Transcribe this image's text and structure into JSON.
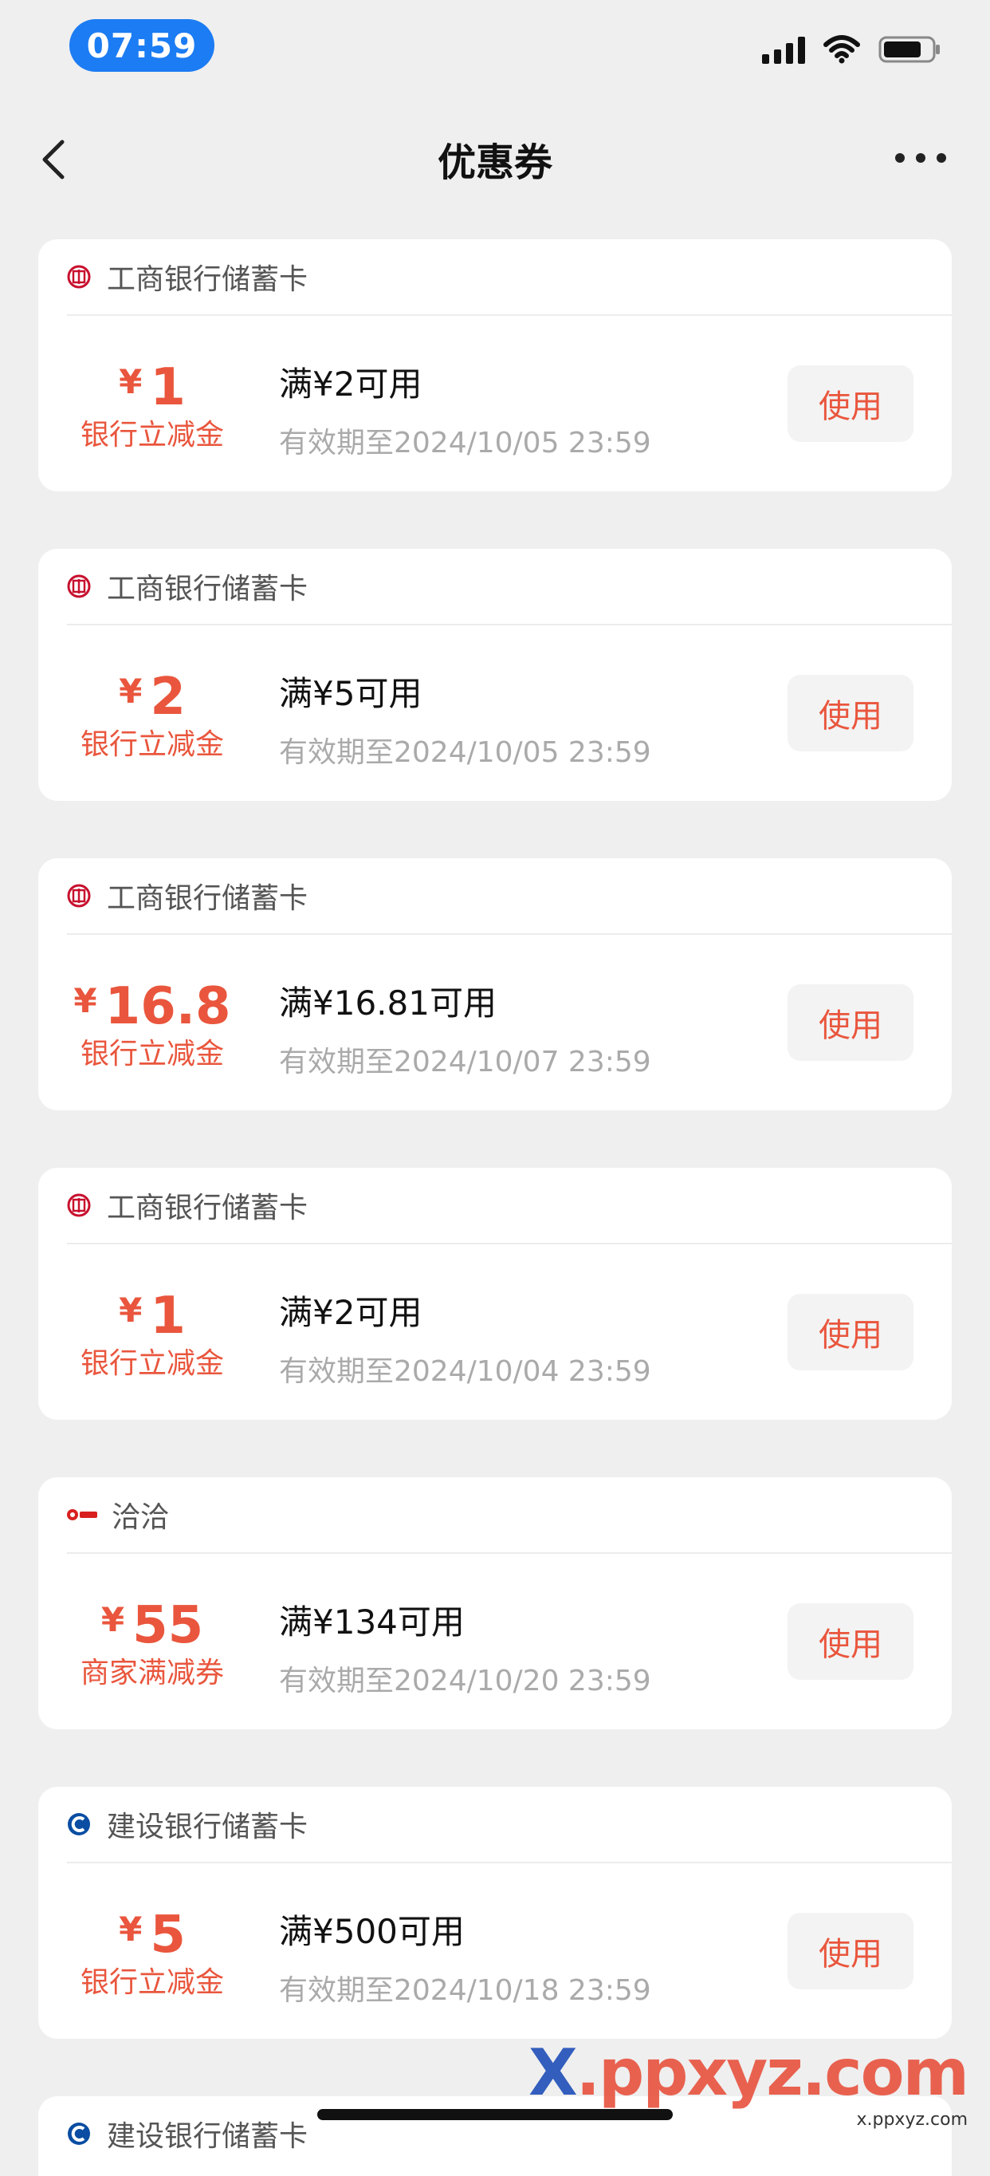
{
  "status_bar": {
    "time": "07:59"
  },
  "nav": {
    "title": "优惠券"
  },
  "colors": {
    "accent": "#e9563d",
    "time_pill": "#1c7cf3",
    "background": "#efefef"
  },
  "coupons": [
    {
      "issuer": "工商银行储蓄卡",
      "logo_icon": "icbc-logo-icon",
      "currency": "¥",
      "amount": "1",
      "type": "银行立减金",
      "condition": "满¥2可用",
      "validity": "有效期至2024/10/05 23:59",
      "button": "使用"
    },
    {
      "issuer": "工商银行储蓄卡",
      "logo_icon": "icbc-logo-icon",
      "currency": "¥",
      "amount": "2",
      "type": "银行立减金",
      "condition": "满¥5可用",
      "validity": "有效期至2024/10/05 23:59",
      "button": "使用"
    },
    {
      "issuer": "工商银行储蓄卡",
      "logo_icon": "icbc-logo-icon",
      "currency": "¥",
      "amount": "16.8",
      "type": "银行立减金",
      "condition": "满¥16.81可用",
      "validity": "有效期至2024/10/07 23:59",
      "button": "使用"
    },
    {
      "issuer": "工商银行储蓄卡",
      "logo_icon": "icbc-logo-icon",
      "currency": "¥",
      "amount": "1",
      "type": "银行立减金",
      "condition": "满¥2可用",
      "validity": "有效期至2024/10/04 23:59",
      "button": "使用"
    },
    {
      "issuer": "洽洽",
      "logo_icon": "qiaqia-logo-icon",
      "currency": "¥",
      "amount": "55",
      "type": "商家满减券",
      "condition": "满¥134可用",
      "validity": "有效期至2024/10/20 23:59",
      "button": "使用"
    },
    {
      "issuer": "建设银行储蓄卡",
      "logo_icon": "ccb-logo-icon",
      "currency": "¥",
      "amount": "5",
      "type": "银行立减金",
      "condition": "满¥500可用",
      "validity": "有效期至2024/10/18 23:59",
      "button": "使用"
    }
  ],
  "partial_coupon": {
    "issuer": "建设银行储蓄卡"
  },
  "watermark": {
    "main_x": "X",
    "main_rest": ".ppxyz.com",
    "sub": "x.ppxyz.com"
  }
}
